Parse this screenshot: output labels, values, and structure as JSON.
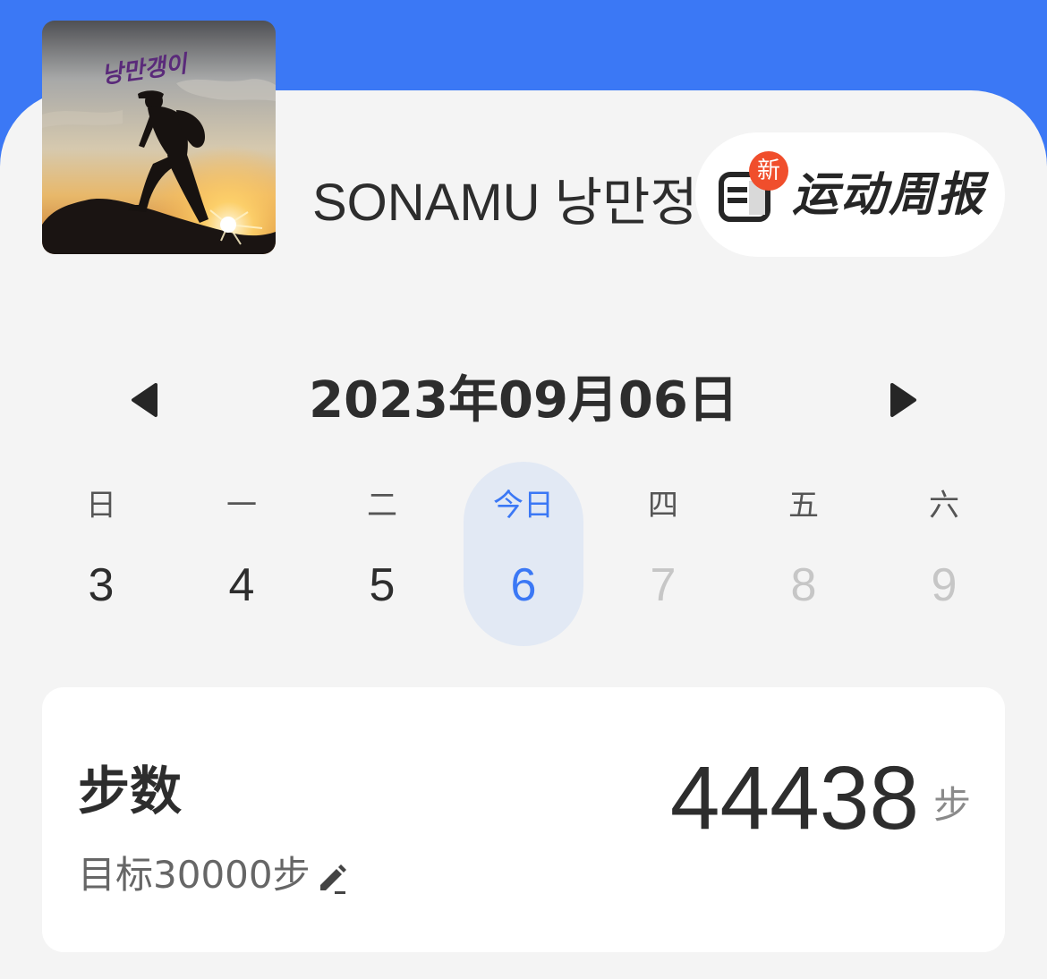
{
  "profile": {
    "username": "SONAMU 낭만정",
    "avatar_caption": "낭만갱이"
  },
  "weekly_report": {
    "badge": "新",
    "label": "运动周报",
    "icon": "report-icon"
  },
  "date_nav": {
    "prev_icon": "triangle-left-icon",
    "next_icon": "triangle-right-icon",
    "current_date": "2023年09月06日"
  },
  "week": [
    {
      "weekday": "日",
      "day": "3",
      "state": "past"
    },
    {
      "weekday": "一",
      "day": "4",
      "state": "past"
    },
    {
      "weekday": "二",
      "day": "5",
      "state": "past"
    },
    {
      "weekday": "今日",
      "day": "6",
      "state": "today"
    },
    {
      "weekday": "四",
      "day": "7",
      "state": "future"
    },
    {
      "weekday": "五",
      "day": "8",
      "state": "future"
    },
    {
      "weekday": "六",
      "day": "9",
      "state": "future"
    }
  ],
  "steps": {
    "title": "步数",
    "goal": "目标30000步",
    "value": "44438",
    "unit": "步",
    "edit_icon": "pencil-icon"
  },
  "colors": {
    "header_blue": "#3b78f5",
    "today_highlight": "#e2e9f4",
    "badge_red": "#f04e2c"
  }
}
